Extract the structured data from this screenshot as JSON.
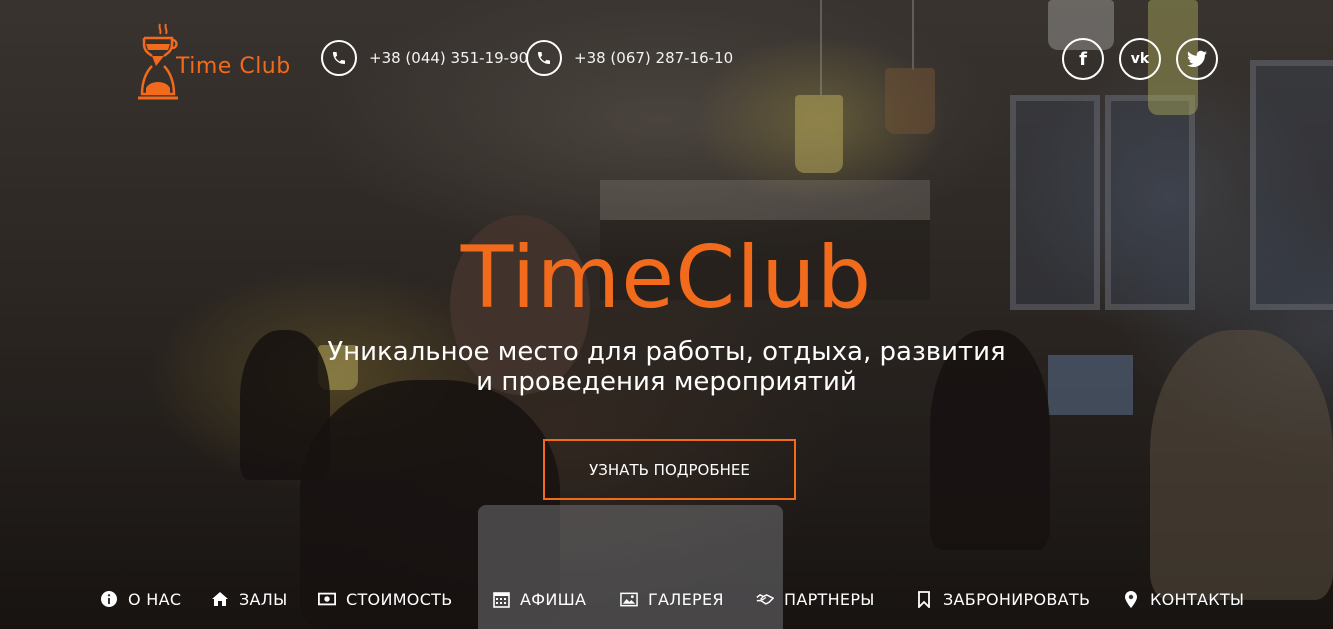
{
  "brand": {
    "name": "Time Club",
    "accent": "#f26a1b"
  },
  "header": {
    "phones": [
      {
        "icon": "phone-icon",
        "number": "+38 (044) 351-19-90"
      },
      {
        "icon": "phone-icon",
        "number": "+38 (067) 287-16-10"
      }
    ],
    "social": [
      {
        "icon": "facebook-icon",
        "glyph": "f"
      },
      {
        "icon": "vk-icon",
        "glyph": "vk"
      },
      {
        "icon": "twitter-icon",
        "glyph": "t"
      }
    ]
  },
  "hero": {
    "title": "TimeClub",
    "subtitle_line1": "Уникальное место для работы, отдыха, развития",
    "subtitle_line2": "и проведения мероприятий",
    "button_label": "УЗНАТЬ ПОДРОБНЕЕ"
  },
  "nav": {
    "items": [
      {
        "icon": "info-icon",
        "label": "О НАС"
      },
      {
        "icon": "home-icon",
        "label": "ЗАЛЫ"
      },
      {
        "icon": "money-icon",
        "label": "СТОИМОСТЬ"
      },
      {
        "icon": "calendar-icon",
        "label": "АФИША"
      },
      {
        "icon": "picture-icon",
        "label": "ГАЛЕРЕЯ"
      },
      {
        "icon": "handshake-icon",
        "label": "ПАРТНЕРЫ"
      },
      {
        "icon": "bookmark-icon",
        "label": "ЗАБРОНИРОВАТЬ"
      },
      {
        "icon": "map-marker-icon",
        "label": "КОНТАКТЫ"
      }
    ]
  }
}
